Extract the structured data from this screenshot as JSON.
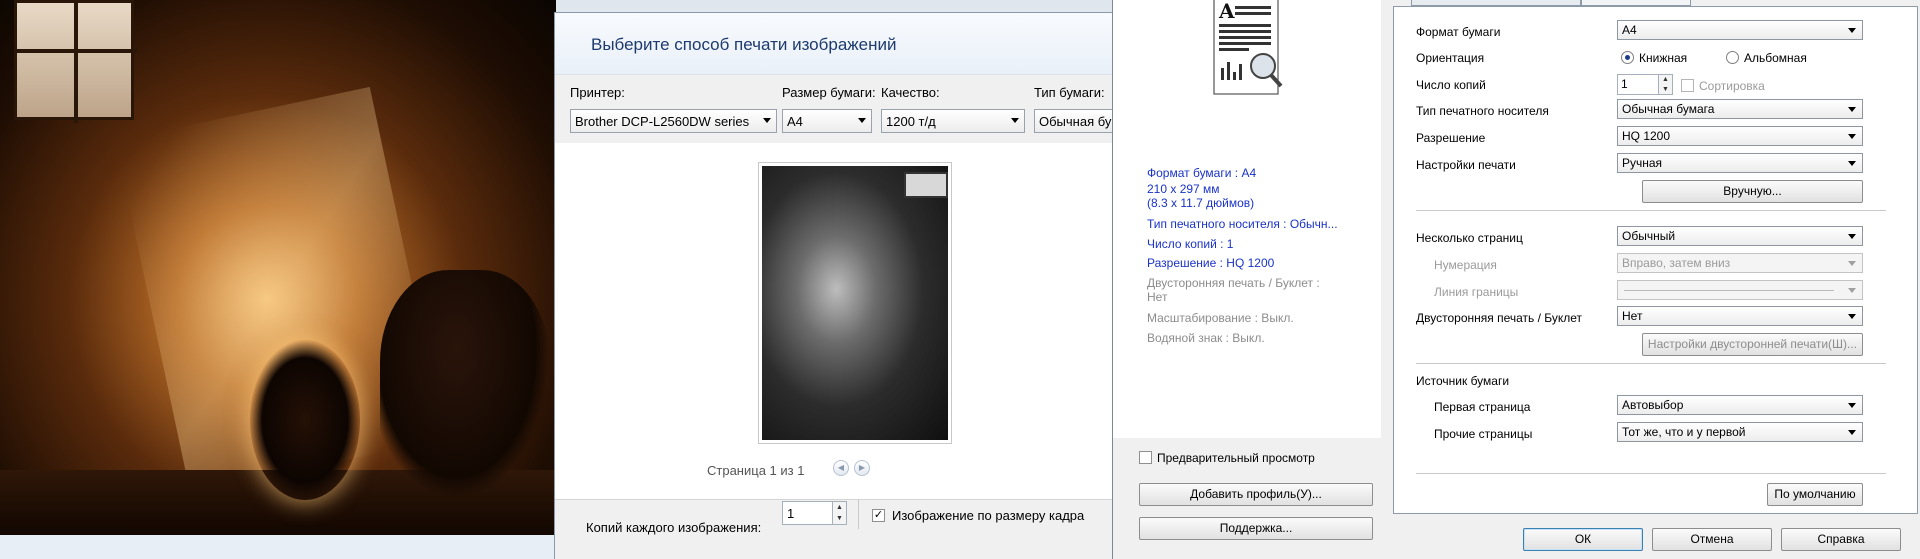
{
  "print_pictures": {
    "title": "Выберите способ печати изображений",
    "printer_label": "Принтер:",
    "printer_value": "Brother DCP-L2560DW series",
    "paper_size_label": "Размер бумаги:",
    "paper_size_value": "A4",
    "quality_label": "Качество:",
    "quality_value": "1200 т/д",
    "paper_type_label": "Тип бумаги:",
    "paper_type_value": "Обычная бу",
    "pager_text": "Страница 1 из 1",
    "copies_label": "Копий каждого изображения:",
    "copies_value": "1",
    "fit_label": "Изображение по размеру кадра",
    "fit_checked": true
  },
  "brother": {
    "info": {
      "paper_format": "Формат бумаги : A4",
      "paper_mm": "210 x 297 мм",
      "paper_in": "(8.3 x 11.7 дюймов)",
      "media_type": "Тип печатного носителя : Обычн...",
      "copies": "Число копий : 1",
      "resolution": "Разрешение : HQ 1200",
      "duplex_line1": "Двусторонняя печать / Буклет :",
      "duplex_line2": "Нет",
      "scaling": "Масштабирование : Выкл.",
      "watermark": "Водяной знак : Выкл."
    },
    "preview_checkbox": "Предварительный просмотр",
    "add_profile_button": "Добавить профиль(У)...",
    "support_button": "Поддержка...",
    "fields": {
      "paper_format_label": "Формат бумаги",
      "paper_format_value": "A4",
      "orientation_label": "Ориентация",
      "orientation_portrait": "Книжная",
      "orientation_landscape": "Альбомная",
      "copies_label": "Число копий",
      "copies_value": "1",
      "collate_label": "Сортировка",
      "media_label": "Тип печатного носителя",
      "media_value": "Обычная бумага",
      "resolution_label": "Разрешение",
      "resolution_value": "HQ 1200",
      "print_settings_label": "Настройки печати",
      "print_settings_value": "Ручная",
      "manual_button": "Вручную...",
      "multipage_label": "Несколько страниц",
      "multipage_value": "Обычный",
      "numbering_label": "Нумерация",
      "numbering_value": "Вправо, затем вниз",
      "border_label": "Линия границы",
      "duplex_label": "Двусторонняя печать / Буклет",
      "duplex_value": "Нет",
      "duplex_settings_button": "Настройки двусторонней печати(Ш)...",
      "paper_source_label": "Источник бумаги",
      "first_page_label": "Первая страница",
      "first_page_value": "Автовыбор",
      "other_pages_label": "Прочие страницы",
      "other_pages_value": "Тот же, что и у первой",
      "default_button": "По умолчанию"
    },
    "ok_button": "ОК",
    "cancel_button": "Отмена",
    "help_button": "Справка"
  }
}
